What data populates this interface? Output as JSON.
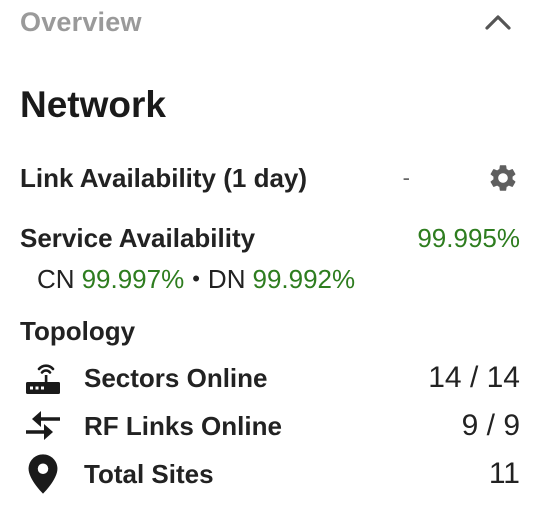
{
  "overview": {
    "title": "Overview",
    "collapse_icon": "chevron-up-icon"
  },
  "network": {
    "title": "Network",
    "link_availability": {
      "label": "Link Availability (1 day)",
      "value": "-",
      "settings_icon": "gear-icon"
    },
    "service_availability": {
      "label": "Service Availability",
      "value": "99.995%",
      "cn_label": "CN",
      "cn_value": "99.997%",
      "separator": "•",
      "dn_label": "DN",
      "dn_value": "99.992%"
    },
    "topology": {
      "title": "Topology",
      "items": [
        {
          "icon": "router-icon",
          "label": "Sectors Online",
          "value": "14 / 14"
        },
        {
          "icon": "link-arrows-icon",
          "label": "RF Links Online",
          "value": "9 / 9"
        },
        {
          "icon": "location-pin-icon",
          "label": "Total Sites",
          "value": "11"
        }
      ]
    }
  },
  "colors": {
    "accent_green": "#2e7d1f",
    "header_gray": "#9a9a9a",
    "text_dark": "#222222"
  }
}
